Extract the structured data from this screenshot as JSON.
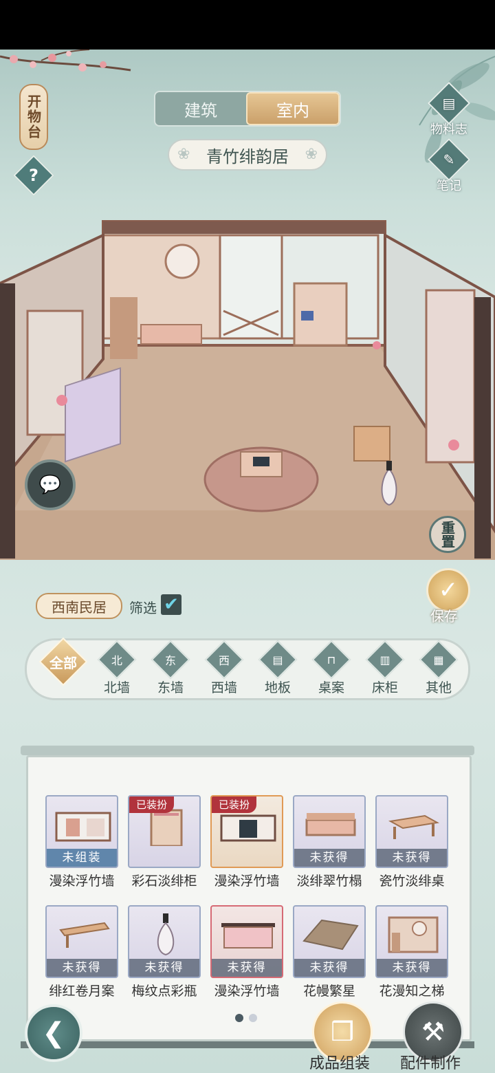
{
  "header": {
    "vertical_title": "开物台",
    "help_icon": "?",
    "tabs": [
      {
        "label": "建筑",
        "active": false
      },
      {
        "label": "室内",
        "active": true
      }
    ],
    "room_name": "青竹绯韵居",
    "side_buttons": [
      {
        "label": "物料志",
        "icon": "book-icon"
      },
      {
        "label": "笔记",
        "icon": "notebook-icon"
      }
    ]
  },
  "scene": {
    "chat_icon": "chat-bubble-icon",
    "reset_label": "重置"
  },
  "panel": {
    "style_chip": "西南民居",
    "filter_label": "筛选",
    "filter_checked": true,
    "save_label": "保存",
    "categories": [
      {
        "label": "全部",
        "icon": "全部",
        "active": true
      },
      {
        "label": "北墙",
        "icon": "北"
      },
      {
        "label": "东墙",
        "icon": "东"
      },
      {
        "label": "西墙",
        "icon": "西"
      },
      {
        "label": "地板",
        "icon": "▤"
      },
      {
        "label": "桌案",
        "icon": "⊓"
      },
      {
        "label": "床柜",
        "icon": "▥"
      },
      {
        "label": "其他",
        "icon": "▦"
      }
    ],
    "items": [
      {
        "name": "漫染浮竹墙",
        "state": "未组装",
        "tag": "",
        "border": "plain"
      },
      {
        "name": "彩石淡绯柜",
        "state": "",
        "tag": "已装扮",
        "border": "plain"
      },
      {
        "name": "漫染浮竹墙",
        "state": "",
        "tag": "已装扮",
        "border": "orange"
      },
      {
        "name": "淡绯翠竹榻",
        "state": "未获得",
        "tag": "",
        "border": "plain"
      },
      {
        "name": "瓷竹淡绯桌",
        "state": "未获得",
        "tag": "",
        "border": "plain"
      },
      {
        "name": "绯红卷月案",
        "state": "未获得",
        "tag": "",
        "border": "plain"
      },
      {
        "name": "梅纹点彩瓶",
        "state": "未获得",
        "tag": "",
        "border": "plain"
      },
      {
        "name": "漫染浮竹墙",
        "state": "未获得",
        "tag": "",
        "border": "red"
      },
      {
        "name": "花幔繁星",
        "state": "未获得",
        "tag": "",
        "border": "plain"
      },
      {
        "name": "花漫知之梯",
        "state": "未获得",
        "tag": "",
        "border": "plain"
      }
    ],
    "page_dots": {
      "total": 2,
      "current": 1
    },
    "actions": [
      {
        "label": "成品组装",
        "icon": "blocks-icon"
      },
      {
        "label": "配件制作",
        "icon": "anvil-icon"
      }
    ]
  },
  "colors": {
    "accent_gold": "#caa06a",
    "teal": "#547b78",
    "tag_red": "#b1333c"
  }
}
